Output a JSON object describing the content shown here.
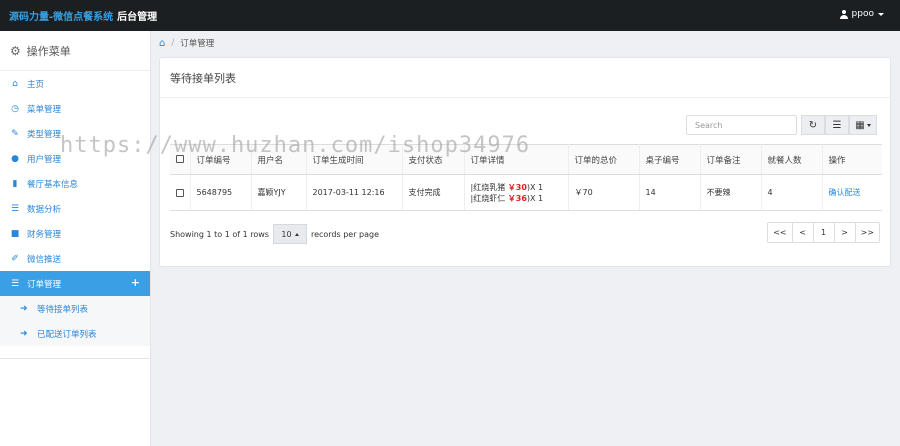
{
  "topbar": {
    "brand": "源码力量-微信点餐系统",
    "subtitle": "后台管理",
    "user": "ppoo"
  },
  "sidebar": {
    "header": "操作菜单",
    "items": [
      {
        "icon": "home-icon",
        "label": "主页"
      },
      {
        "icon": "clock-icon",
        "label": "菜单管理"
      },
      {
        "icon": "edit-icon",
        "label": "类型管理"
      },
      {
        "icon": "user-icon",
        "label": "用户管理"
      },
      {
        "icon": "bar-chart-icon",
        "label": "餐厅基本信息"
      },
      {
        "icon": "list-icon",
        "label": "数据分析"
      },
      {
        "icon": "book-icon",
        "label": "财务管理"
      },
      {
        "icon": "pencil-icon",
        "label": "微信推送"
      },
      {
        "icon": "list-icon",
        "label": "订单管理",
        "active": true
      }
    ],
    "sub_items": [
      {
        "icon": "arrow-icon",
        "label": "等待接单列表"
      },
      {
        "icon": "arrow-icon",
        "label": "已配送订单列表"
      }
    ]
  },
  "breadcrumb": {
    "current": "订单管理"
  },
  "panel": {
    "title": "等待接单列表"
  },
  "toolbar": {
    "search_placeholder": "Search"
  },
  "table": {
    "columns": [
      "订单编号",
      "用户名",
      "订单生成时间",
      "支付状态",
      "订单详情",
      "订单的总价",
      "桌子编号",
      "订单备注",
      "就餐人数",
      "操作"
    ],
    "rows": [
      {
        "order_id": "5648795",
        "user": "嘉颖YJY",
        "time": "2017-03-11 12:16",
        "pay_status": "支付完成",
        "detail": [
          {
            "name": "|红烧乳猪",
            "price": "￥30",
            "qty": ")X 1"
          },
          {
            "name": "|红烧虾仁",
            "price": "￥36",
            "qty": ")X 1"
          }
        ],
        "total": "￥70",
        "table_no": "14",
        "remark": "不要辣",
        "diners": "4",
        "action": "确认配送"
      }
    ]
  },
  "footer": {
    "showing": "Showing 1 to 1 of 1 rows",
    "per_page": "10",
    "per_page_suffix": "records per page"
  },
  "pagination": [
    "<<",
    "<",
    "1",
    ">",
    ">>"
  ],
  "watermark": "https://www.huzhan.com/ishop34976"
}
